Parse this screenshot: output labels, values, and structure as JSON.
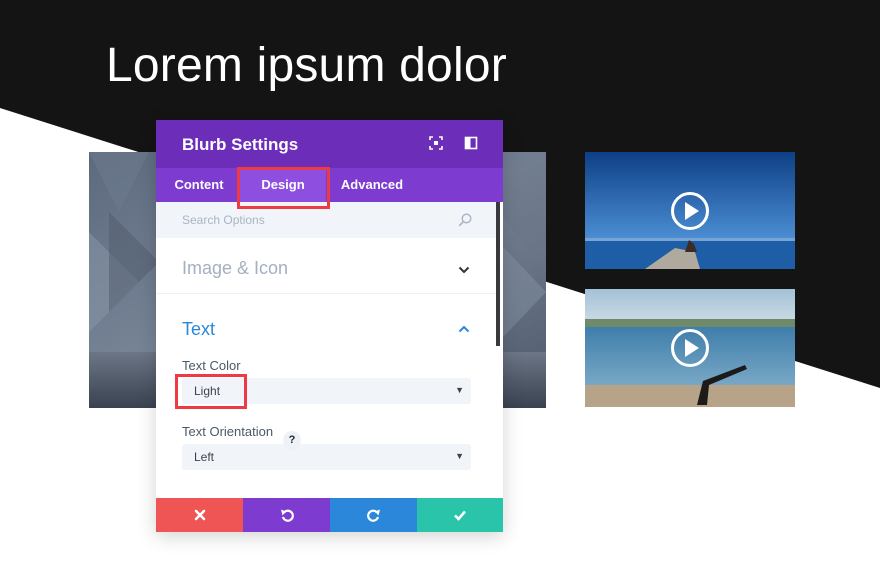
{
  "page": {
    "title": "Lorem ipsum dolor",
    "colors": {
      "dark_band": "#141414",
      "background": "#ffffff"
    }
  },
  "media": {
    "large_image": {
      "icon": "architecture-photo"
    },
    "thumbnails": [
      {
        "icon": "play-icon",
        "scene": "beach-yoga"
      },
      {
        "icon": "play-icon",
        "scene": "beach-yoga"
      }
    ]
  },
  "modal": {
    "title": "Blurb Settings",
    "header_icons": [
      "expand-icon",
      "sidebar-layout-icon"
    ],
    "colors": {
      "header": "#6c2eb9",
      "tabs": "#7d3bd0",
      "active_tab": "#8e4fe0",
      "section_active": "#2b87da",
      "highlight": "#ee3a43"
    },
    "tabs": [
      {
        "label": "Content",
        "active": false
      },
      {
        "label": "Design",
        "active": true
      },
      {
        "label": "Advanced",
        "active": false
      }
    ],
    "search": {
      "placeholder": "Search Options",
      "value": ""
    },
    "sections": [
      {
        "label": "Image & Icon",
        "expanded": false
      },
      {
        "label": "Text",
        "expanded": true
      }
    ],
    "fields": {
      "text_color": {
        "label": "Text Color",
        "value": "Light"
      },
      "text_orientation": {
        "label": "Text Orientation",
        "help": "?",
        "value": "Left"
      }
    },
    "footer": {
      "buttons": [
        {
          "action": "cancel",
          "icon": "close-icon",
          "color": "#ef5555"
        },
        {
          "action": "undo",
          "icon": "undo-icon",
          "color": "#7d3bd0"
        },
        {
          "action": "redo",
          "icon": "redo-icon",
          "color": "#2b87da"
        },
        {
          "action": "save",
          "icon": "check-icon",
          "color": "#29c4a9"
        }
      ]
    }
  }
}
